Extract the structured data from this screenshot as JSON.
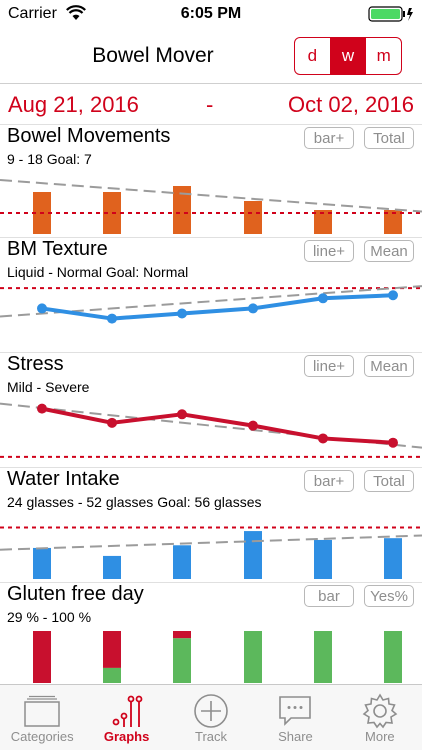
{
  "status": {
    "carrier": "Carrier",
    "time": "6:05 PM"
  },
  "nav": {
    "title": "Bowel Mover",
    "segments": [
      "d",
      "w",
      "m"
    ],
    "active_segment": "w"
  },
  "dates": {
    "start": "Aug 21, 2016",
    "separator": "-",
    "end": "Oct 02, 2016"
  },
  "colors": {
    "accent": "#d0021b",
    "orange": "#e0621e",
    "blue": "#2f8fe3",
    "green": "#5cb85c",
    "red": "#c8102e",
    "trend": "#9b9b9b"
  },
  "panels": [
    {
      "title": "Bowel Movements",
      "subtitle": "9  - 18  Goal: 7",
      "btn1": "bar+",
      "btn2": "Total",
      "chart_data": {
        "type": "bar",
        "values": [
          14,
          14,
          16,
          11,
          8,
          8
        ],
        "ylim": [
          0,
          23
        ],
        "goal": 7,
        "trend": [
          18,
          7.5
        ]
      }
    },
    {
      "title": "BM Texture",
      "subtitle": "Liquid - Normal Goal: Normal",
      "btn1": "line+",
      "btn2": "Mean",
      "chart_data": {
        "type": "line",
        "values": [
          4.0,
          3.0,
          3.5,
          4.0,
          5.0,
          5.3
        ],
        "ylim": [
          0,
          7
        ],
        "goal": 6.0,
        "trend": [
          3.2,
          6.2
        ]
      }
    },
    {
      "title": "Stress",
      "subtitle": "Mild - Severe",
      "btn1": "line+",
      "btn2": "Mean",
      "chart_data": {
        "type": "line",
        "values": [
          5.8,
          3.8,
          5.0,
          3.4,
          1.6,
          1.0
        ],
        "ylim": [
          -2,
          8
        ],
        "goal": -1,
        "trend": [
          6.5,
          0.3
        ]
      }
    },
    {
      "title": "Water Intake",
      "subtitle": "24 glasses - 52 glasses Goal: 56 glasses",
      "btn1": "bar+",
      "btn2": "Total",
      "chart_data": {
        "type": "bar",
        "values": [
          35,
          26,
          38,
          54,
          44,
          46
        ],
        "ylim": [
          0,
          80
        ],
        "goal": 58,
        "trend": [
          33,
          49
        ]
      }
    },
    {
      "title": "Gluten free day",
      "subtitle": " 29 % - 100 %",
      "btn1": "bar",
      "btn2": "Yes%",
      "chart_data": {
        "type": "bar",
        "stacked": true,
        "yes_percent": [
          0,
          29,
          86,
          100,
          100,
          100
        ]
      }
    }
  ],
  "tabs": [
    {
      "label": "Categories",
      "icon": "folder-icon"
    },
    {
      "label": "Graphs",
      "icon": "graph-icon"
    },
    {
      "label": "Track",
      "icon": "plus-circle-icon"
    },
    {
      "label": "Share",
      "icon": "message-icon"
    },
    {
      "label": "More",
      "icon": "gear-icon"
    }
  ]
}
